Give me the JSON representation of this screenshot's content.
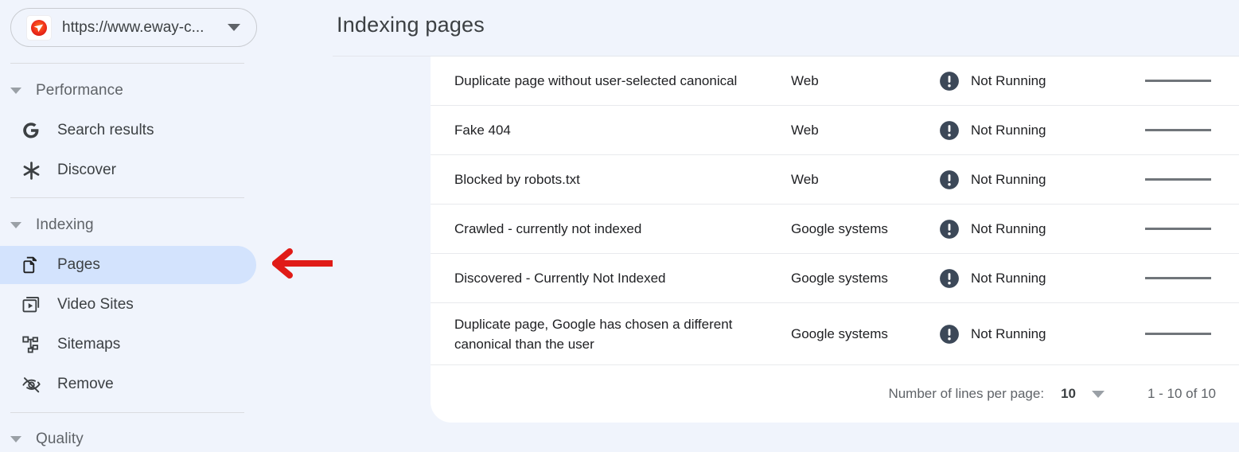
{
  "colors": {
    "page_background": "#f0f4fc",
    "card_background": "#ffffff",
    "active_nav_pill": "#d3e3fd",
    "annotation_arrow": "#e01b17",
    "status_icon": "#3c4858",
    "favicon": "#ea2f1f"
  },
  "sidebar": {
    "property_selector": {
      "icon": "site-favicon-icon",
      "url": "https://www.eway-c...",
      "caret_icon": "chevron-down-icon"
    },
    "sections": [
      {
        "label": "Performance",
        "caret_icon": "caret-down-icon"
      },
      {
        "label": "Indexing",
        "caret_icon": "caret-down-icon"
      },
      {
        "label": "Quality",
        "caret_icon": "caret-down-icon"
      }
    ],
    "items": [
      {
        "label": "Search results",
        "icon": "google-g-icon",
        "active": false
      },
      {
        "label": "Discover",
        "icon": "discover-asterisk-icon",
        "active": false
      },
      {
        "label": "Pages",
        "icon": "pages-copy-icon",
        "active": true
      },
      {
        "label": "Video Sites",
        "icon": "video-sites-icon",
        "active": false
      },
      {
        "label": "Sitemaps",
        "icon": "sitemaps-hierarchy-icon",
        "active": false
      },
      {
        "label": "Remove",
        "icon": "eye-off-icon",
        "active": false
      }
    ]
  },
  "annotation": {
    "type": "arrow",
    "direction": "left",
    "points_to": "Pages",
    "color": "#e01b17"
  },
  "main": {
    "title": "Indexing pages",
    "table": {
      "rows": [
        {
          "reason": "Duplicate page without user-selected canonical",
          "source": "Web",
          "validation": "Not Running",
          "status_icon": "exclamation-circle-icon",
          "trend": "flat-line"
        },
        {
          "reason": "Fake 404",
          "source": "Web",
          "validation": "Not Running",
          "status_icon": "exclamation-circle-icon",
          "trend": "flat-line"
        },
        {
          "reason": "Blocked by robots.txt",
          "source": "Web",
          "validation": "Not Running",
          "status_icon": "exclamation-circle-icon",
          "trend": "flat-line"
        },
        {
          "reason": "Crawled - currently not indexed",
          "source": "Google systems",
          "validation": "Not Running",
          "status_icon": "exclamation-circle-icon",
          "trend": "flat-line"
        },
        {
          "reason": "Discovered - Currently Not Indexed",
          "source": "Google systems",
          "validation": "Not Running",
          "status_icon": "exclamation-circle-icon",
          "trend": "flat-line"
        },
        {
          "reason": "Duplicate page, Google has chosen a different canonical than the user",
          "source": "Google systems",
          "validation": "Not Running",
          "status_icon": "exclamation-circle-icon",
          "trend": "flat-line"
        }
      ],
      "footer": {
        "lines_per_page_label": "Number of lines per page:",
        "lines_per_page_value": "10",
        "caret_icon": "caret-down-icon",
        "range": "1 - 10 of 10"
      }
    }
  }
}
